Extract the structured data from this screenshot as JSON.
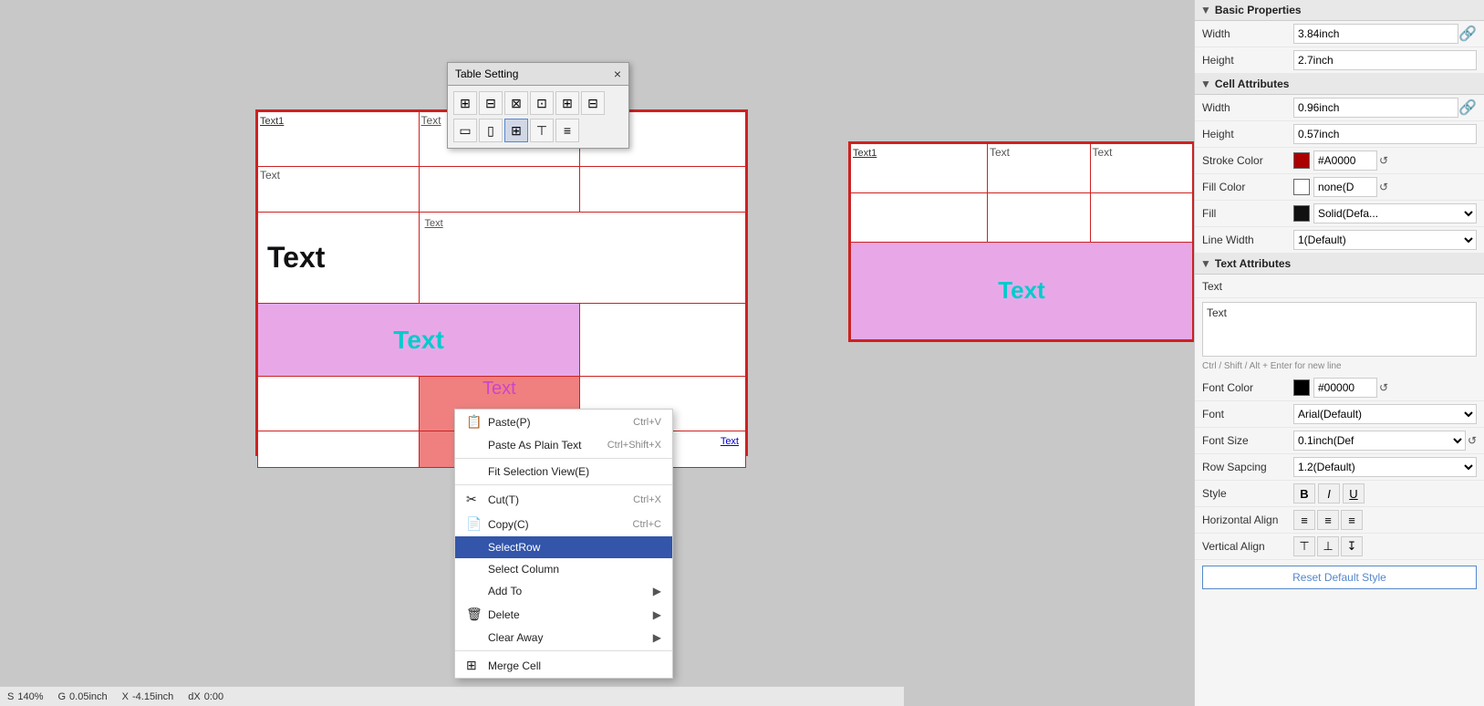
{
  "dialog": {
    "title": "Table Setting",
    "close_label": "×"
  },
  "context_menu": {
    "items": [
      {
        "id": "paste",
        "icon": "📋",
        "label": "Paste(P)",
        "shortcut": "Ctrl+V",
        "has_arrow": false,
        "highlighted": false
      },
      {
        "id": "paste-plain",
        "icon": "",
        "label": "Paste As Plain Text",
        "shortcut": "Ctrl+Shift+X",
        "has_arrow": false,
        "highlighted": false
      },
      {
        "id": "fit-selection",
        "icon": "",
        "label": "Fit Selection View(E)",
        "shortcut": "",
        "has_arrow": false,
        "highlighted": false
      },
      {
        "id": "cut",
        "icon": "✂",
        "label": "Cut(T)",
        "shortcut": "Ctrl+X",
        "has_arrow": false,
        "highlighted": false
      },
      {
        "id": "copy",
        "icon": "📄",
        "label": "Copy(C)",
        "shortcut": "Ctrl+C",
        "has_arrow": false,
        "highlighted": false
      },
      {
        "id": "select-row",
        "icon": "",
        "label": "SelectRow",
        "shortcut": "",
        "has_arrow": false,
        "highlighted": true
      },
      {
        "id": "select-column",
        "icon": "",
        "label": "Select Column",
        "shortcut": "",
        "has_arrow": false,
        "highlighted": false
      },
      {
        "id": "add-to",
        "icon": "",
        "label": "Add To",
        "shortcut": "",
        "has_arrow": true,
        "highlighted": false
      },
      {
        "id": "delete",
        "icon": "🗑",
        "label": "Delete",
        "shortcut": "",
        "has_arrow": true,
        "highlighted": false
      },
      {
        "id": "clear-away",
        "icon": "",
        "label": "Clear Away",
        "shortcut": "",
        "has_arrow": true,
        "highlighted": false
      },
      {
        "id": "merge-cell",
        "icon": "",
        "label": "Merge Cell",
        "shortcut": "",
        "has_arrow": false,
        "highlighted": false
      }
    ]
  },
  "properties": {
    "title": "Basic Properties",
    "width_label": "Width",
    "width_value": "3.84inch",
    "height_label": "Height",
    "height_value": "2.7inch",
    "cell_attributes_title": "Cell Attributes",
    "cell_width_label": "Width",
    "cell_width_value": "0.96inch",
    "cell_height_label": "Height",
    "cell_height_value": "0.57inch",
    "stroke_color_label": "Stroke Color",
    "stroke_color_value": "#A0000",
    "stroke_color_hex": "#aa0000",
    "fill_color_label": "Fill Color",
    "fill_color_value": "none(D",
    "fill_label": "Fill",
    "fill_value": "Solid(Defa...",
    "line_width_label": "Line Width",
    "line_width_value": "1(Default)",
    "text_attributes_title": "Text Attributes",
    "text_label": "Text",
    "text_value": "Text",
    "text_hint": "Ctrl / Shift / Alt + Enter for new line",
    "font_color_label": "Font Color",
    "font_color_value": "#00000",
    "font_color_hex": "#000000",
    "font_label": "Font",
    "font_value": "Arial(Default)",
    "font_size_label": "Font Size",
    "font_size_value": "0.1inch(Def",
    "row_spacing_label": "Row Sapcing",
    "row_spacing_value": "1.2(Default)",
    "style_label": "Style",
    "style_bold": "B",
    "style_italic": "I",
    "style_underline": "U",
    "horizontal_align_label": "Horizontal Align",
    "vertical_align_label": "Vertical Align",
    "reset_button_label": "Reset Default Style"
  },
  "status_bar": {
    "scale_label": "S",
    "scale_value": "140%",
    "g_label": "G",
    "g_value": "0.05inch",
    "x_label": "X",
    "x_value": "-4.15inch",
    "dx_label": "dX",
    "dx_value": "0:00"
  },
  "table_cells": {
    "cell1_text": "Text1",
    "cell_text": "Text",
    "cell_big": "Text",
    "cell_cyan": "Text",
    "cell_magenta": "Text",
    "cell_top_right_text": "Text"
  },
  "right_table": {
    "cell_text1": "Text1",
    "cell_text": "Text",
    "cell_cyan": "Text"
  }
}
